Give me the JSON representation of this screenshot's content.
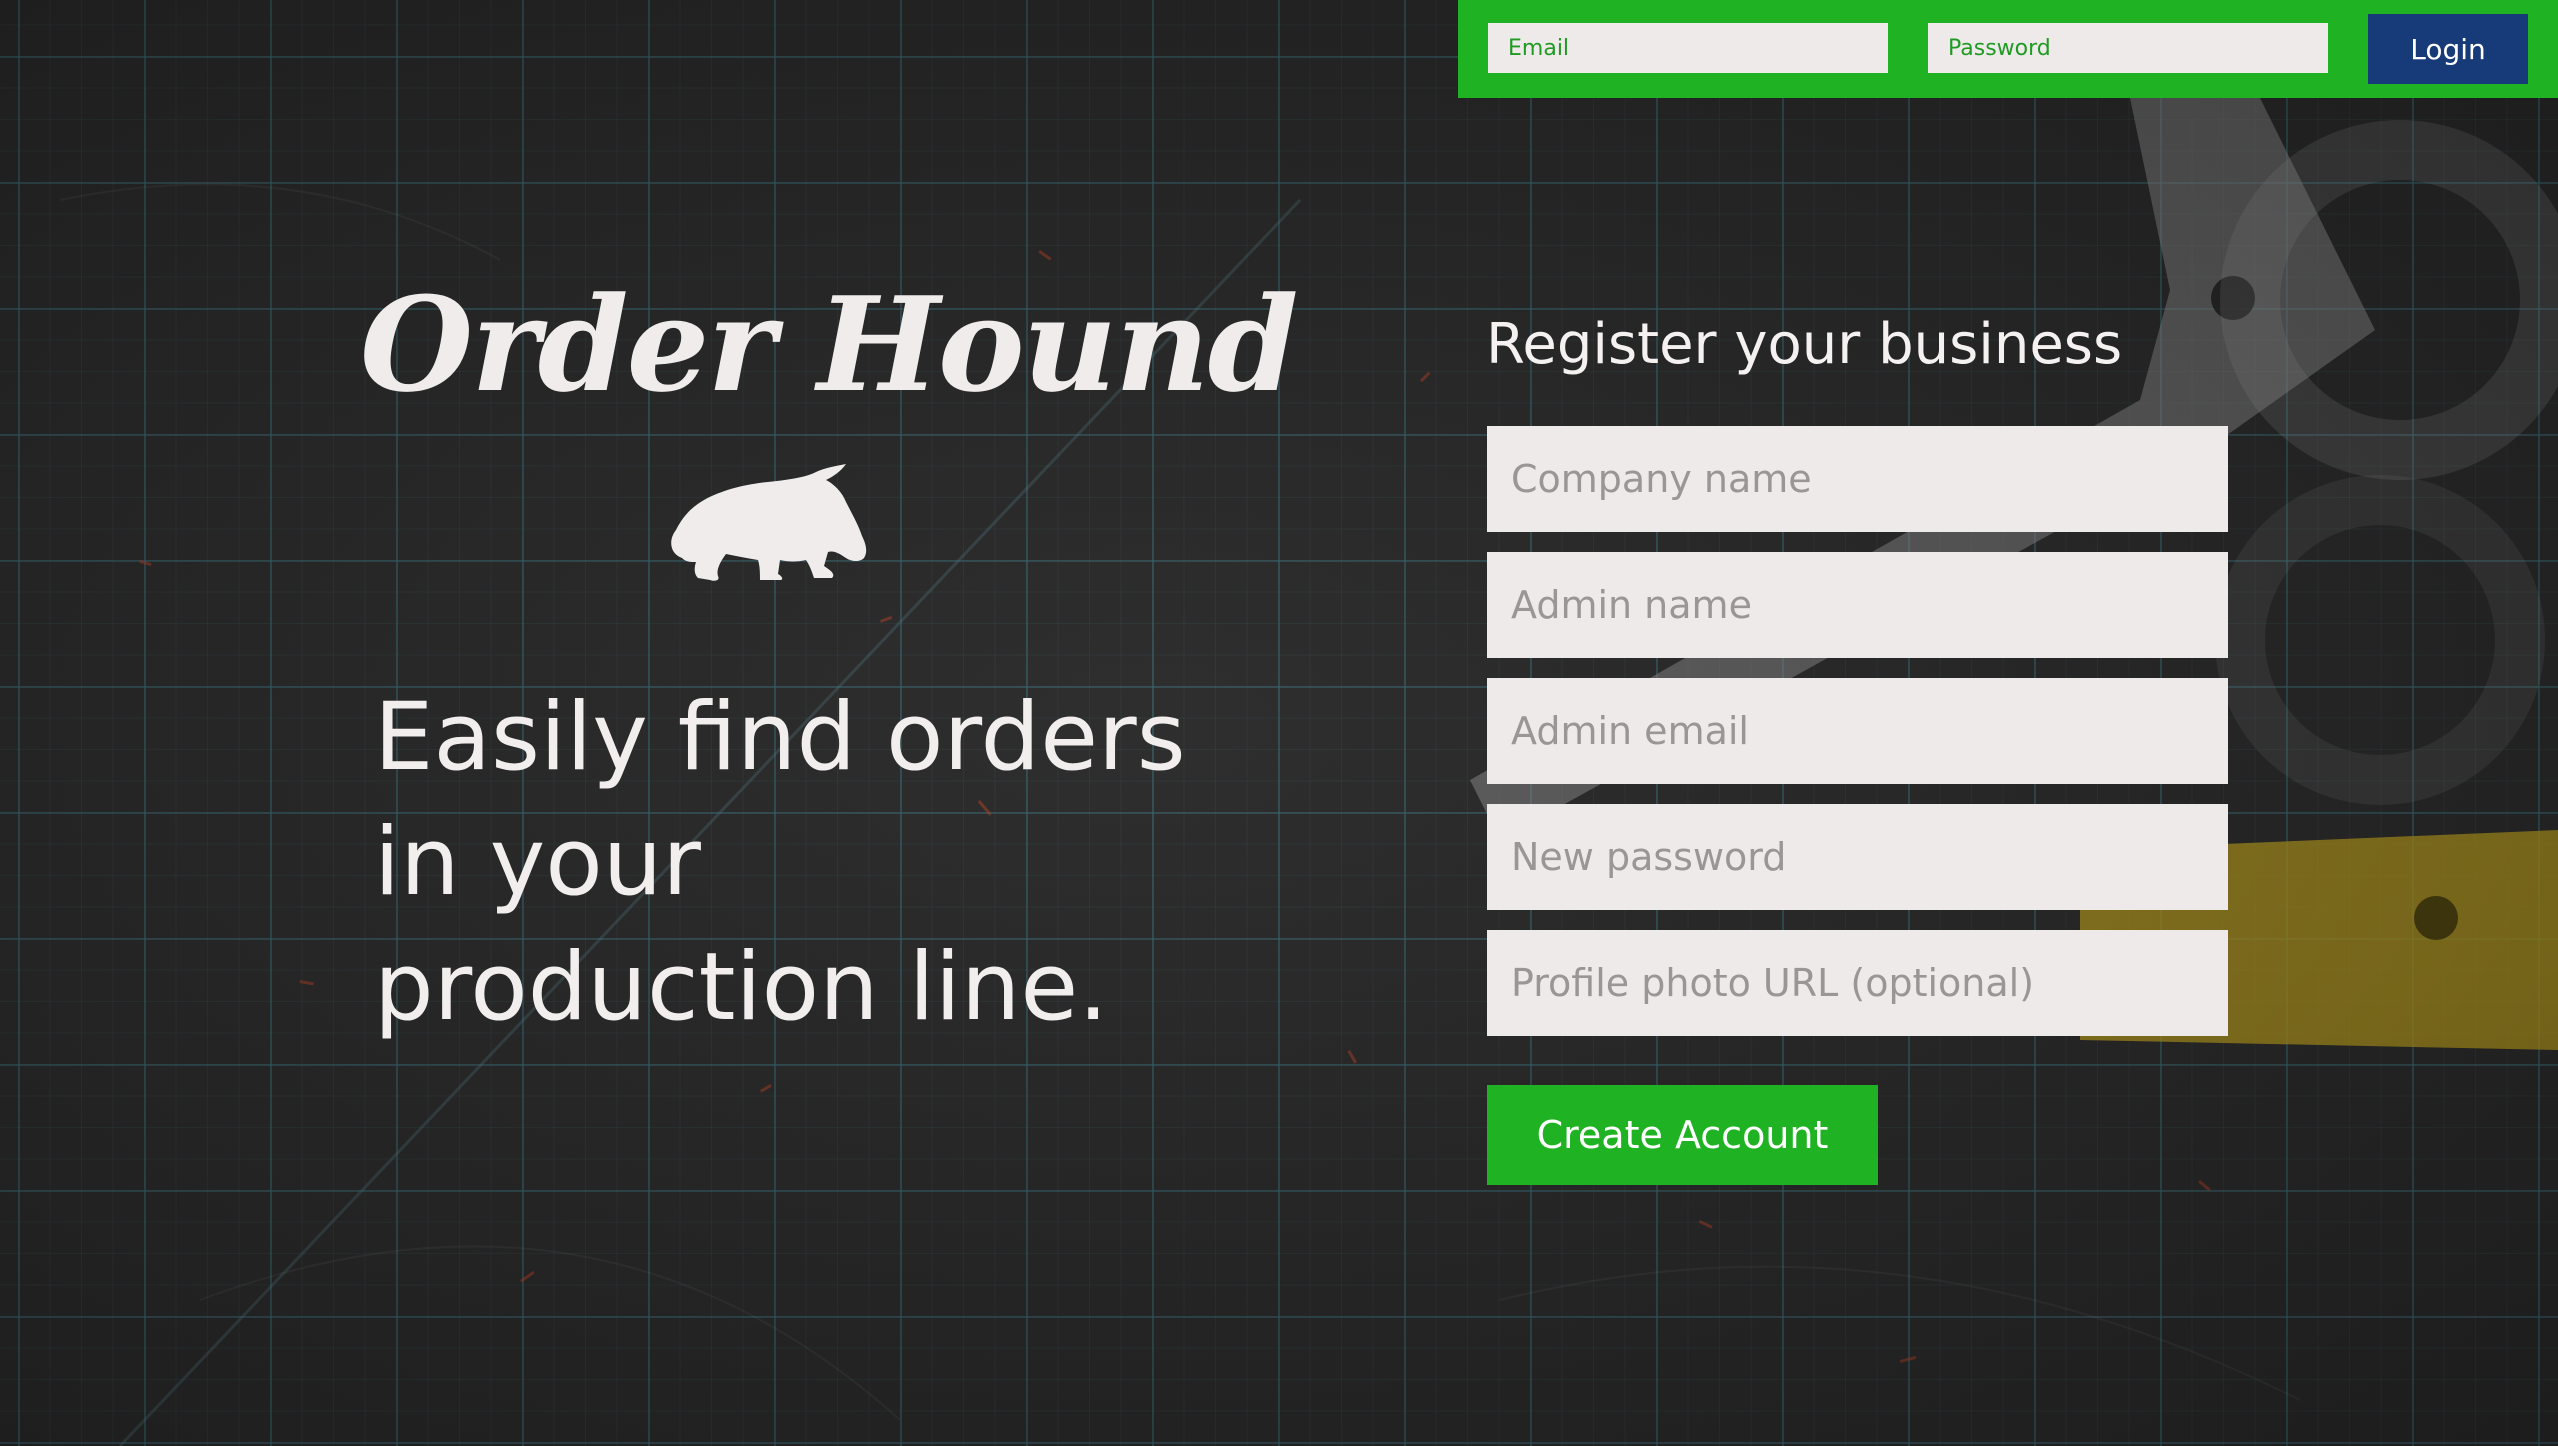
{
  "login": {
    "email_placeholder": "Email",
    "password_placeholder": "Password",
    "login_label": "Login"
  },
  "brand": {
    "title": "Order Hound",
    "logo_icon": "dog-sniffing-icon",
    "tagline": "Easily find orders in your production line."
  },
  "register": {
    "title": "Register your business",
    "fields": [
      {
        "placeholder": "Company name",
        "value": ""
      },
      {
        "placeholder": "Admin name",
        "value": ""
      },
      {
        "placeholder": "Admin email",
        "value": ""
      },
      {
        "placeholder": "New password",
        "value": ""
      },
      {
        "placeholder": "Profile photo URL (optional)",
        "value": ""
      }
    ],
    "submit_label": "Create Account"
  },
  "colors": {
    "accent_green": "#1fb324",
    "login_button_blue": "#173a79",
    "input_background": "#eeeaea",
    "text_light": "#f1ecec"
  }
}
